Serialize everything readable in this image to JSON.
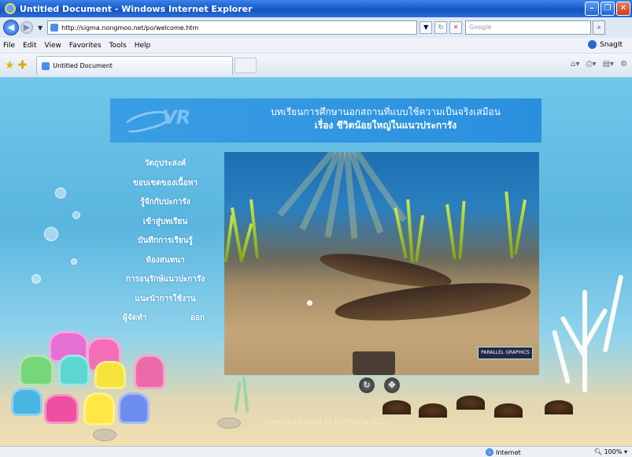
{
  "window": {
    "title": "Untitled Document - Windows Internet Explorer",
    "min_label": "–",
    "max_label": "❐",
    "close_label": "✕"
  },
  "address": {
    "url": "http://sigma.nongmoo.net/po/welcome.htm",
    "search_placeholder": "Google"
  },
  "menu": {
    "items": [
      "File",
      "Edit",
      "View",
      "Favorites",
      "Tools",
      "Help"
    ],
    "snagit_label": "SnagIt"
  },
  "tabs": {
    "active_label": "Untitled Document"
  },
  "page": {
    "logo_text": "VR",
    "header_title": "บทเรียนการศึกษานอกสถานที่แบบใช้ความเป็นจริงเสมือน",
    "header_subtitle": "เรื่อง ชีวิตน้อยใหญ่ในแนวประการัง",
    "nav": [
      "วัตถุประสงค์",
      "ขอบเขตของเนื้อหา",
      "รู้จักกับปะการัง",
      "เข้าสู่บทเรียน",
      "บันทึกการเรียนรู้",
      "ห้องสนทนา",
      "การอนุรักษ์แนวปะการัง",
      "แนะนำการใช้งาน"
    ],
    "nav_author": "ผู้จัดทำ",
    "nav_exit": "ออก",
    "viewer_brand": "PARALLEL GRAPHICS",
    "download_text": "Download plug-in (Cortona 3D)"
  },
  "status": {
    "zone": "Internet",
    "zoom": "100%"
  },
  "colors": {
    "titlebar": "#1a5fd0",
    "page_header": "#2a90de",
    "sea_top": "#6fc7ea",
    "sand": "#f0dfb2"
  }
}
